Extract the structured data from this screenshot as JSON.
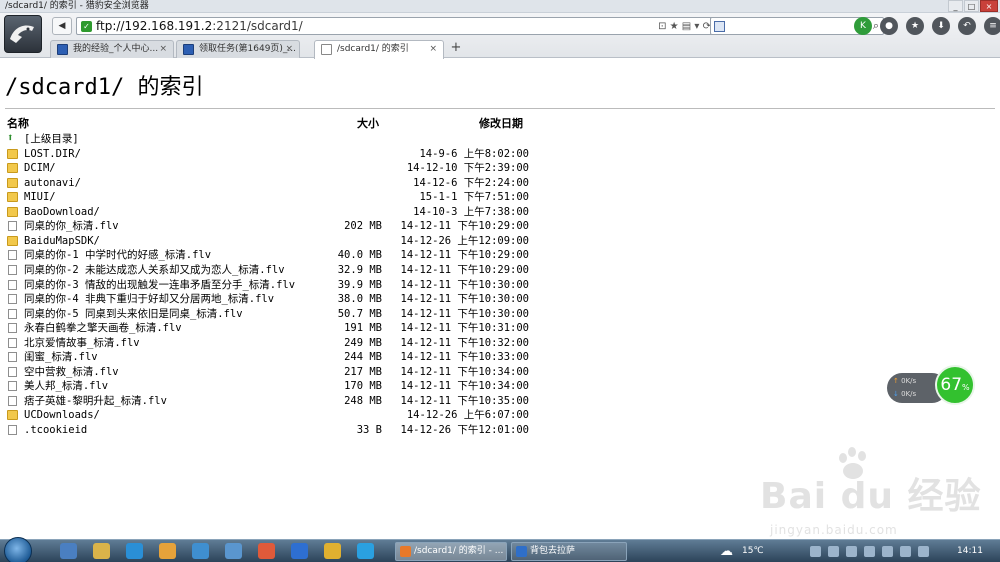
{
  "window": {
    "title": "/sdcard1/ 的索引 - 猎豹安全浏览器",
    "buttons": [
      "_",
      "□",
      "×"
    ]
  },
  "toolbar": {
    "back_label": "◀",
    "url_host": "ftp://192.168.191.2",
    "url_rest": ":2121/sdcard1/",
    "addr_tools": "⊡ ★ ▤ ▾ ⟳",
    "search_icon": "search-engine-icon",
    "icons": [
      "K",
      "●",
      "★",
      "⬇",
      "↶",
      "≡"
    ]
  },
  "tabs": [
    {
      "label": "我的经验_个人中心...",
      "close": "×"
    },
    {
      "label": "领取任务(第1649页)_...",
      "close": "×"
    },
    {
      "label": "/sdcard1/ 的索引",
      "close": "×"
    }
  ],
  "newtab_label": "+",
  "page": {
    "heading": "/sdcard1/ 的索引",
    "col_name": "名称",
    "col_size": "大小",
    "col_date": "修改日期"
  },
  "rows": [
    {
      "type": "up",
      "name": "[上级目录]",
      "size": "",
      "date": ""
    },
    {
      "type": "folder",
      "name": "LOST.DIR/",
      "size": "",
      "date": "14-9-6 上午8:02:00"
    },
    {
      "type": "folder",
      "name": "DCIM/",
      "size": "",
      "date": "14-12-10 下午2:39:00"
    },
    {
      "type": "folder",
      "name": "autonavi/",
      "size": "",
      "date": "14-12-6 下午2:24:00"
    },
    {
      "type": "folder",
      "name": "MIUI/",
      "size": "",
      "date": "15-1-1 下午7:51:00"
    },
    {
      "type": "folder",
      "name": "BaoDownload/",
      "size": "",
      "date": "14-10-3 上午7:38:00"
    },
    {
      "type": "file",
      "name": "同桌的你_标清.flv",
      "size": "202 MB",
      "date": "14-12-11 下午10:29:00"
    },
    {
      "type": "folder",
      "name": "BaiduMapSDK/",
      "size": "",
      "date": "14-12-26 上午12:09:00"
    },
    {
      "type": "file",
      "name": "同桌的你-1 中学时代的好感_标清.flv",
      "size": "40.0 MB",
      "date": "14-12-11 下午10:29:00"
    },
    {
      "type": "file",
      "name": "同桌的你-2 未能达成恋人关系却又成为恋人_标清.flv",
      "size": "32.9 MB",
      "date": "14-12-11 下午10:29:00"
    },
    {
      "type": "file",
      "name": "同桌的你-3 情敌的出现触发一连串矛盾至分手_标清.flv",
      "size": "39.9 MB",
      "date": "14-12-11 下午10:30:00"
    },
    {
      "type": "file",
      "name": "同桌的你-4 非典下重归于好却又分居两地_标清.flv",
      "size": "38.0 MB",
      "date": "14-12-11 下午10:30:00"
    },
    {
      "type": "file",
      "name": "同桌的你-5 同桌到头来依旧是同桌_标清.flv",
      "size": "50.7 MB",
      "date": "14-12-11 下午10:30:00"
    },
    {
      "type": "file",
      "name": "永春白鹤拳之擎天画卷_标清.flv",
      "size": "191 MB",
      "date": "14-12-11 下午10:31:00"
    },
    {
      "type": "file",
      "name": "北京爱情故事_标清.flv",
      "size": "249 MB",
      "date": "14-12-11 下午10:32:00"
    },
    {
      "type": "file",
      "name": "闺蜜_标清.flv",
      "size": "244 MB",
      "date": "14-12-11 下午10:33:00"
    },
    {
      "type": "file",
      "name": "空中营救_标清.flv",
      "size": "217 MB",
      "date": "14-12-11 下午10:34:00"
    },
    {
      "type": "file",
      "name": "美人邦_标清.flv",
      "size": "170 MB",
      "date": "14-12-11 下午10:34:00"
    },
    {
      "type": "file",
      "name": "痞子英雄-黎明升起_标清.flv",
      "size": "248 MB",
      "date": "14-12-11 下午10:35:00"
    },
    {
      "type": "folder",
      "name": "UCDownloads/",
      "size": "",
      "date": "14-12-26 上午6:07:00"
    },
    {
      "type": "file",
      "name": ".tcookieid",
      "size": "33 B",
      "date": "14-12-26 下午12:01:00"
    }
  ],
  "speed_widget": {
    "up": "0K/s",
    "down": "0K/s",
    "percent": "67",
    "percent_unit": "%"
  },
  "watermark": {
    "brand": "Bai du 经验",
    "domain": "jingyan.baidu.com"
  },
  "taskbar": {
    "windows": [
      {
        "label": "/sdcard1/ 的索引 - ...",
        "color": "#e8792a"
      },
      {
        "label": "背包去拉萨",
        "color": "#2f6fc9"
      }
    ],
    "weather": "15℃",
    "clock": "14:11"
  }
}
